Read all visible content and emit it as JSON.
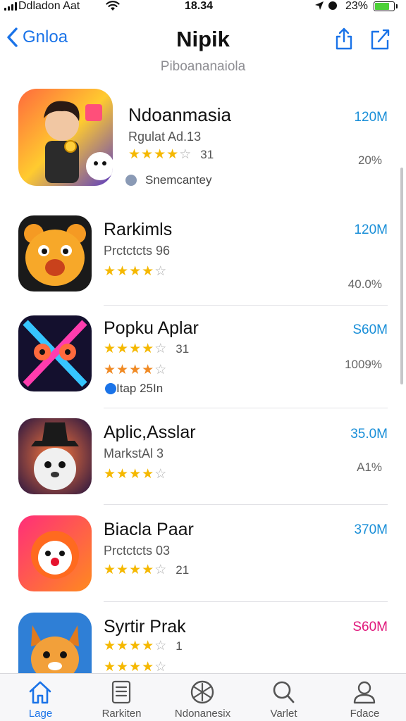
{
  "status_bar": {
    "carrier": "Ddladon Aat",
    "time": "18.34",
    "battery_pct": "23%",
    "battery_level": 0.85
  },
  "nav": {
    "back_label": "Gnloa",
    "title": "Nipik",
    "subtitle": "Piboananaiola"
  },
  "apps": [
    {
      "name": "Ndoanmasia",
      "sub": "Rgulat Ad.13",
      "stars": 3.5,
      "rating_text": "31",
      "tag": "Snemcantey",
      "size": "120M",
      "pct": "20%"
    },
    {
      "name": "Rarkimls",
      "sub": "Prctctcts 96",
      "stars": 4,
      "rating_text": "",
      "tag": "",
      "size": "120M",
      "pct": "40.0%"
    },
    {
      "name": "Popku Aplar",
      "sub": "31",
      "stars": 3.5,
      "rating_text": "",
      "tag": "Itap 25In",
      "size": "S60M",
      "pct": "1009%"
    },
    {
      "name": "Aplic,Asslar",
      "sub": "MarkstAl 3",
      "stars": 4,
      "rating_text": "",
      "tag": "",
      "size": "35.0M",
      "pct": "A1%"
    },
    {
      "name": "Biacla Paar",
      "sub": "Prctctcts 03",
      "stars": 4,
      "rating_text": "21",
      "tag": "",
      "size": "370M",
      "pct": ""
    },
    {
      "name": "Syrtir Prak",
      "sub": "1",
      "stars": 4,
      "rating_text": "",
      "tag": "",
      "size": "S60M",
      "pct": ""
    }
  ],
  "tabs": [
    {
      "label": "Lage",
      "icon": "home-icon",
      "active": true
    },
    {
      "label": "Rarkiten",
      "icon": "list-icon",
      "active": false
    },
    {
      "label": "Ndonanesix",
      "icon": "games-icon",
      "active": false
    },
    {
      "label": "Varlet",
      "icon": "search-icon",
      "active": false
    },
    {
      "label": "Fdace",
      "icon": "profile-icon",
      "active": false
    }
  ],
  "colors": {
    "accent": "#1a73e8",
    "size_text": "#1a8fd8",
    "star": "#f5b800",
    "pink_size": "#e0187c"
  }
}
